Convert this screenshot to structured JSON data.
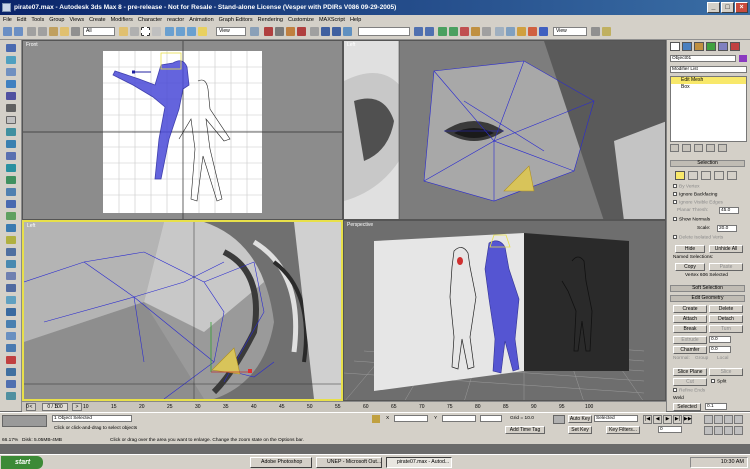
{
  "window": {
    "title": "pirate07.max - Autodesk 3ds Max 8 - pre-release - Not for Resale - Stand-alone License (Vesper with PDIRs V086 09-29-2005)"
  },
  "menu": [
    "File",
    "Edit",
    "Tools",
    "Group",
    "Views",
    "Create",
    "Modifiers",
    "Character",
    "reactor",
    "Animation",
    "Graph Editors",
    "Rendering",
    "Customize",
    "MAXScript",
    "Help"
  ],
  "toolbar": {
    "selection_filter": "All",
    "ref_coord": "View",
    "named_selection": "",
    "view_dropdown_right": "View"
  },
  "viewports": {
    "top_left": "Front",
    "top_right": "Left",
    "bottom_left": "Left",
    "bottom_right": "Perspective"
  },
  "command_panel": {
    "object_name": "Object01",
    "modifier_list": "Modifier List",
    "stack": [
      "Edit Mesh",
      "Box"
    ],
    "selection_header": "Selection",
    "by_vertex": "By Vertex",
    "ignore_backfacing": "Ignore Backfacing",
    "ignore_visible_edges": "Ignore Visible Edges",
    "planar_thresh_label": "Planar Thresh:",
    "planar_thresh_value": "45.0",
    "show_normals": "Show Normals",
    "scale_label": "Scale:",
    "scale_value": "20.0",
    "delete_isolated": "Delete Isolated Verts",
    "hide": "Hide",
    "unhide_all": "Unhide All",
    "named_selections": "Named Selections:",
    "copy": "Copy",
    "paste": "Paste",
    "vertex_count": "Vertex 606 Selected",
    "soft_selection": "Soft Selection",
    "edit_geometry": "Edit Geometry",
    "create": "Create",
    "delete": "Delete",
    "attach": "Attach",
    "detach": "Detach",
    "break": "Break",
    "turn": "Turn",
    "extrude": "Extrude",
    "extrude_value": "0.0",
    "chamfer": "Chamfer",
    "chamfer_value": "0.0",
    "normal_label": "Normal:",
    "group": "Group",
    "local": "Local",
    "slice_plane": "Slice Plane",
    "slice": "Slice",
    "cut": "Cut",
    "split": "Split",
    "refine_ends": "Refine Ends",
    "weld": "Weld",
    "selected": "Selected",
    "selected_value": "0.1"
  },
  "timeline": {
    "frame_label": "0 / 100",
    "ticks": [
      "0",
      "5",
      "10",
      "15",
      "20",
      "25",
      "30",
      "35",
      "40",
      "45",
      "50",
      "55",
      "60",
      "65",
      "70",
      "75",
      "80",
      "85",
      "90",
      "95",
      "100"
    ]
  },
  "status": {
    "objects_selected": "1 Object Selected",
    "hint": "Click or click-and-drag to select objects",
    "hint2": "Click or drag over the area you want to enlarge. Change the zoom state on the Options bar.",
    "coord_x_label": "X",
    "coord_y_label": "Y",
    "grid": "Grid = 10.0",
    "add_time_tag": "Add Time Tag",
    "auto_key": "Auto Key",
    "set_key": "Set Key",
    "key_mode": "Selected",
    "key_filters": "Key Filters...",
    "frame": "0",
    "left_info1": "66.17%",
    "left_info2": "Disk: 5.05MB-4MB"
  },
  "taskbar": {
    "start": "start",
    "tasks": [
      "Adobe Photoshop",
      "UNEP - Microsoft Out...",
      "pirate07.max - Autod..."
    ],
    "clock": "10:30 AM"
  },
  "colors": {
    "panel": "#d4d0c8",
    "titlebar": "#0a246a",
    "active_viewport_border": "#e8e04a",
    "mesh_blue": "#3a3ad8",
    "viewport_white": "#ffffff"
  }
}
